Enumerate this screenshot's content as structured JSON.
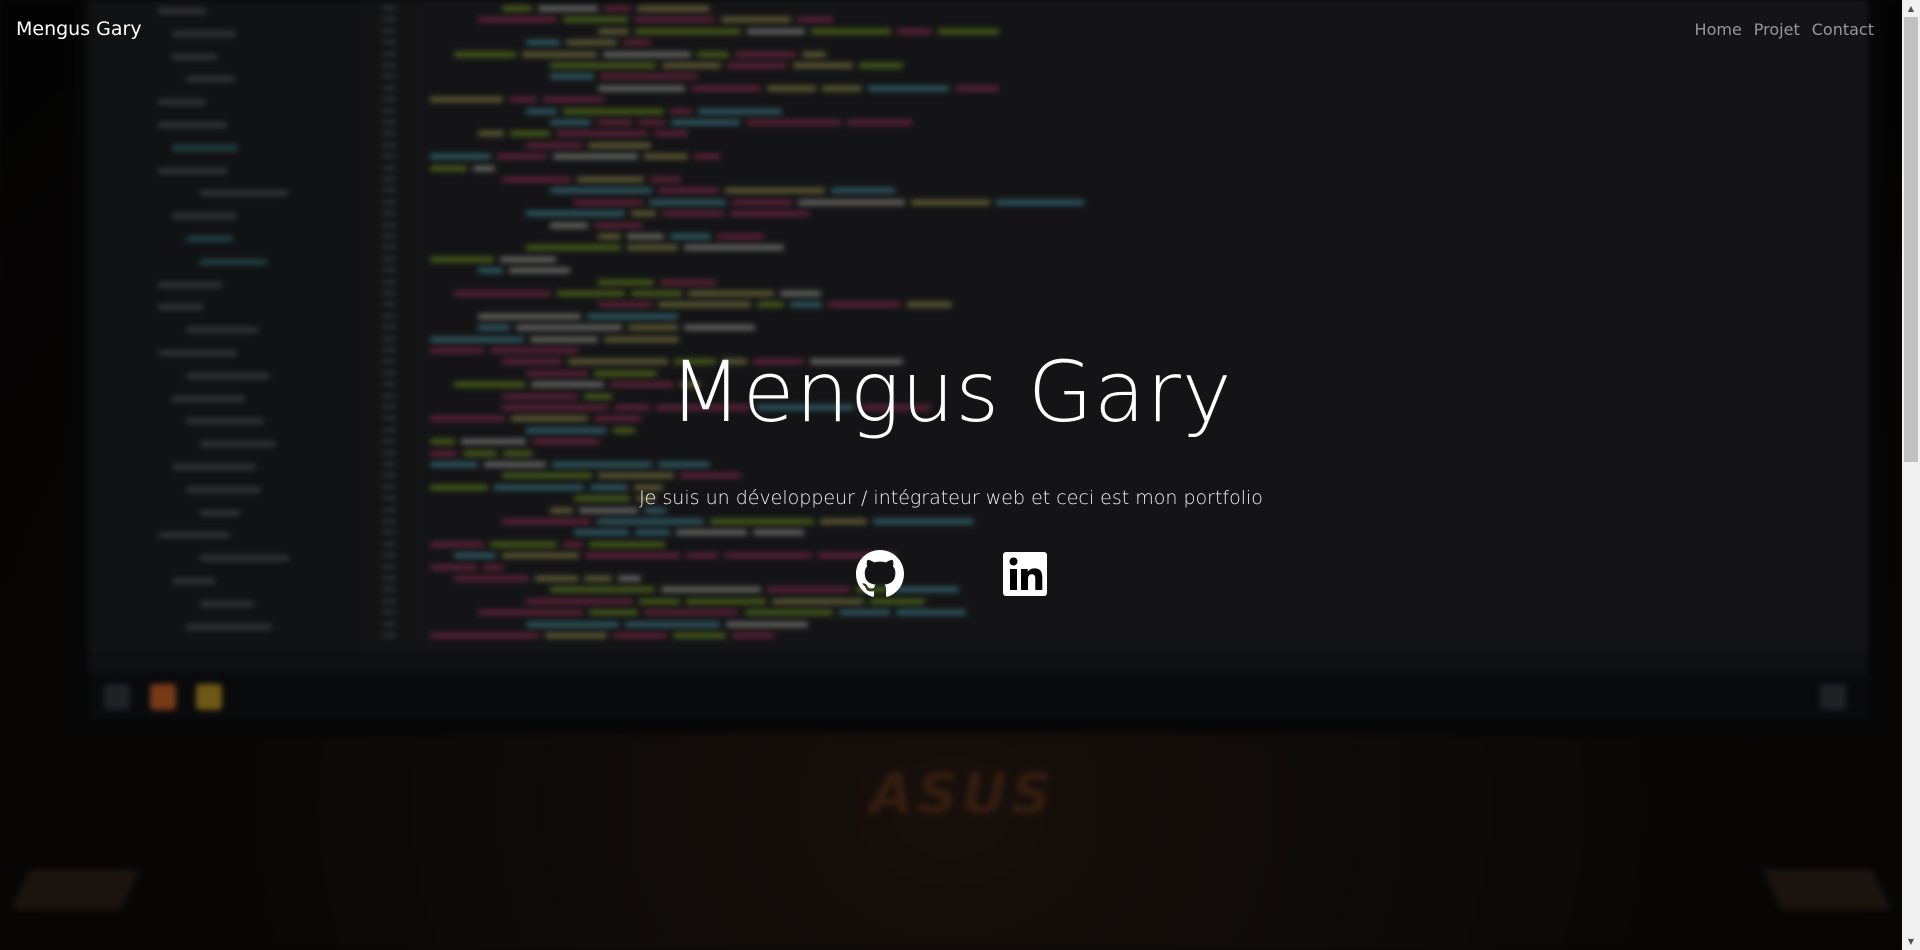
{
  "navbar": {
    "brand": "Mengus Gary",
    "links": [
      "Home",
      "Projet",
      "Contact"
    ]
  },
  "hero": {
    "title": "Mengus Gary",
    "subtitle": "Je suis un développeur / intégrateur web et ceci est mon portfolio"
  },
  "social": {
    "github_icon": "github-icon",
    "linkedin_icon": "linkedin-icon"
  },
  "background": {
    "laptop_logo": "ASUS"
  },
  "colors": {
    "text": "#ffffff",
    "nav_link": "rgba(255,255,255,0.55)",
    "overlay": "rgba(0,0,0,0.45)"
  }
}
